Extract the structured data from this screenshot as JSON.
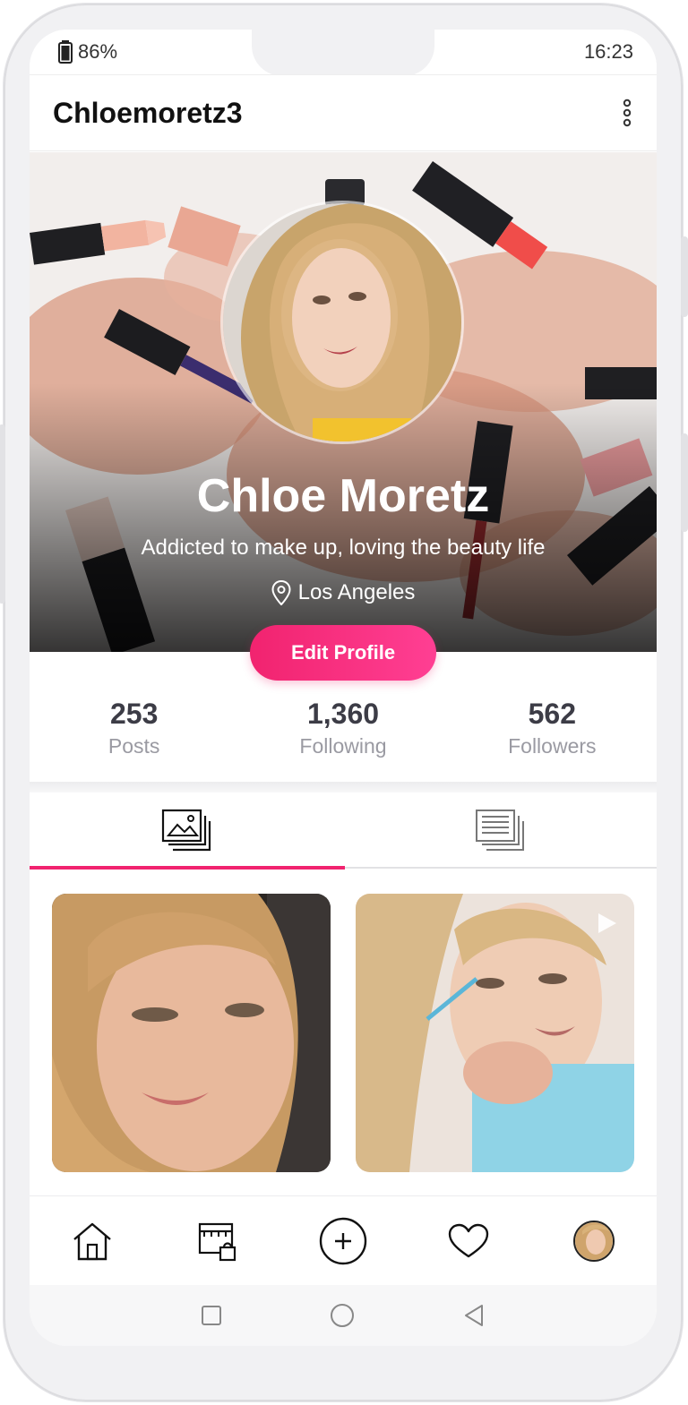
{
  "status_bar": {
    "battery": "86%",
    "time": "16:23"
  },
  "header": {
    "username": "Chloemoretz3"
  },
  "profile": {
    "name": "Chloe Moretz",
    "bio": "Addicted to make up, loving the beauty life",
    "location": "Los Angeles",
    "edit_label": "Edit Profile"
  },
  "stats": [
    {
      "value": "253",
      "label": "Posts"
    },
    {
      "value": "1,360",
      "label": "Following"
    },
    {
      "value": "562",
      "label": "Followers"
    }
  ],
  "tabs": [
    {
      "icon": "photo-grid-icon",
      "active": true
    },
    {
      "icon": "list-icon",
      "active": false
    }
  ],
  "posts": [
    {
      "type": "photo"
    },
    {
      "type": "video"
    }
  ],
  "bottom_nav": [
    "home-icon",
    "shop-icon",
    "add-icon",
    "heart-icon",
    "profile-avatar"
  ],
  "colors": {
    "accent": "#f1236f",
    "text_dark": "#3c3c46",
    "text_muted": "#9a9aa2"
  }
}
